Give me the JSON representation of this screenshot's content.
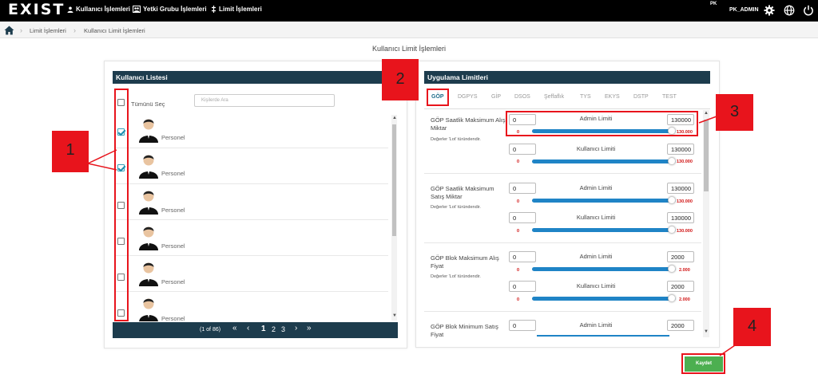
{
  "topbar": {
    "logo": "EXIST",
    "nav": [
      {
        "label": "Kullanıcı İşlemleri",
        "icon": "user-icon"
      },
      {
        "label": "Yetki Grubu İşlemleri",
        "icon": "group-icon"
      },
      {
        "label": "Limit İşlemleri",
        "icon": "limit-icon"
      }
    ],
    "pk_label": "PK",
    "user": "PK_ADMIN",
    "icons": [
      "gear-icon",
      "globe-icon",
      "power-icon"
    ]
  },
  "breadcrumb": {
    "home_icon": "home-icon",
    "items": [
      "Limit İşlemleri",
      "Kullanıcı Limit İşlemleri"
    ]
  },
  "page_title": "Kullanıcı Limit İşlemleri",
  "user_list": {
    "header": "Kullanıcı Listesi",
    "select_all": "Tümünü Seç",
    "search_placeholder": "Kişilerde Ara",
    "users": [
      {
        "label": "Personel",
        "checked": true
      },
      {
        "label": "Personel",
        "checked": true
      },
      {
        "label": "Personel",
        "checked": false
      },
      {
        "label": "Personel",
        "checked": false
      },
      {
        "label": "Personel",
        "checked": false
      },
      {
        "label": "Personel",
        "checked": false
      }
    ],
    "pager": {
      "info": "(1 of 86)",
      "first": "«",
      "prev": "‹",
      "pages": [
        "1",
        "2",
        "3"
      ],
      "next": "›",
      "last": "»"
    }
  },
  "limits": {
    "header": "Uygulama Limitleri",
    "tabs": [
      "GÖP",
      "DGPYS",
      "GİP",
      "DSOS",
      "Şeffaflık",
      "TYS",
      "EKYS",
      "DSTP",
      "TEST"
    ],
    "active_tab": "GÖP",
    "admin_title": "Admin Limiti",
    "user_title": "Kullanıcı Limiti",
    "note": "Değerler 'Lot' türündendir.",
    "items": [
      {
        "label": "GÖP Saatlik Maksimum Alış Miktar",
        "admin": {
          "min": "0",
          "max": "130000",
          "range_min": "0",
          "range_max": "130.000"
        },
        "user": {
          "min": "0",
          "max": "130000",
          "range_min": "0",
          "range_max": "130.000"
        }
      },
      {
        "label": "GÖP Saatlik Maksimum Satış Miktar",
        "admin": {
          "min": "0",
          "max": "130000",
          "range_min": "0",
          "range_max": "130.000"
        },
        "user": {
          "min": "0",
          "max": "130000",
          "range_min": "0",
          "range_max": "130.000"
        }
      },
      {
        "label": "GÖP Blok Maksimum Alış Fiyat",
        "admin": {
          "min": "0",
          "max": "2000",
          "range_min": "0",
          "range_max": "2.000"
        },
        "user": {
          "min": "0",
          "max": "2000",
          "range_min": "0",
          "range_max": "2.000"
        }
      },
      {
        "label": "GÖP Blok Minimum Satış Fiyat",
        "admin": {
          "min": "0",
          "max": "2000"
        }
      }
    ]
  },
  "save_label": "Kaydet",
  "annotations": [
    "1",
    "2",
    "3",
    "4"
  ],
  "colors": {
    "header": "#1d3c4d",
    "slider": "#1f84c6",
    "annotation": "#e8141c",
    "save": "#4caf50"
  }
}
